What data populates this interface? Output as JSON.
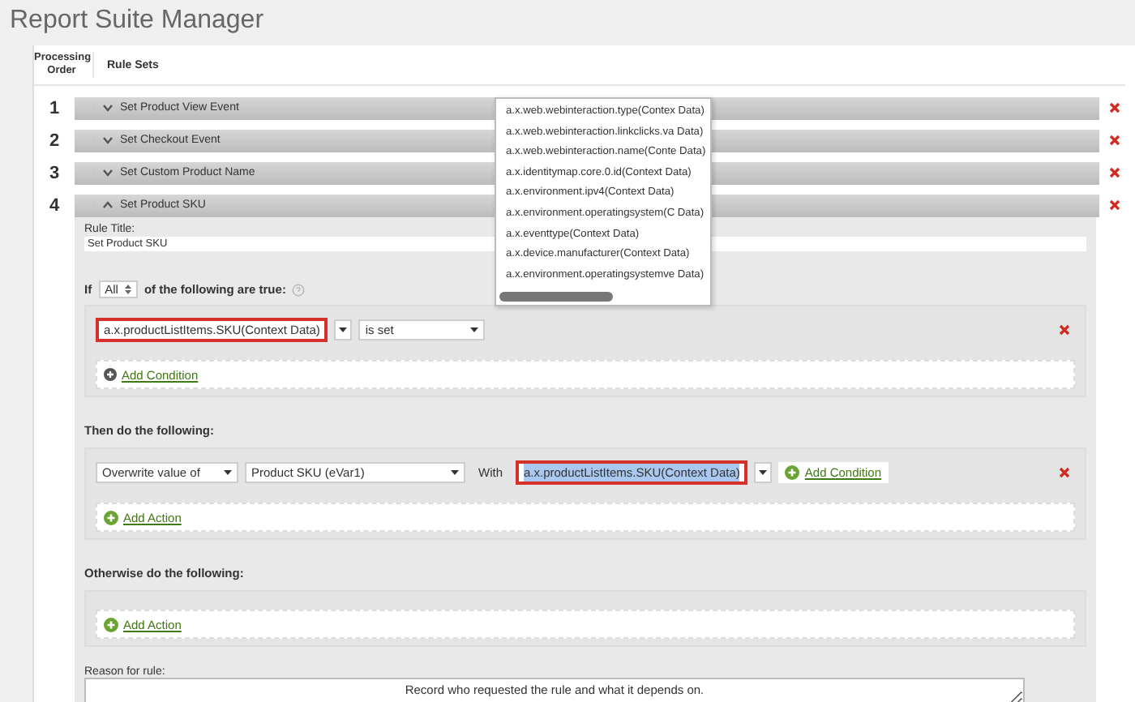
{
  "header": {
    "title": "Report Suite Manager"
  },
  "columns": [
    "Processing Order",
    "Rule Sets"
  ],
  "rules": [
    {
      "order": "1",
      "name": "Set Product View Event",
      "expanded": false
    },
    {
      "order": "2",
      "name": "Set Checkout Event",
      "expanded": false
    },
    {
      "order": "3",
      "name": "Set Custom Product Name",
      "expanded": false
    },
    {
      "order": "4",
      "name": "Set Product SKU",
      "expanded": true
    }
  ],
  "editor": {
    "rule_title_label": "Rule Title:",
    "rule_title_value": "Set Product SKU",
    "if_prefix": "If",
    "match_select": "All",
    "if_suffix": "of the following are true:",
    "conditions": [
      {
        "variable": "a.x.productListItems.SKU(Context Data)",
        "operator": "is set",
        "highlighted": true
      }
    ],
    "add_condition": "Add Condition",
    "then_label": "Then do the following:",
    "actions": [
      {
        "operation": "Overwrite value of",
        "target": "Product SKU (eVar1)",
        "with_label": "With",
        "value": "a.x.productListItems.SKU(Context Data)",
        "highlighted": true,
        "value_selected": true,
        "add_condition": "Add Condition"
      }
    ],
    "add_action": "Add Action",
    "otherwise_label": "Otherwise do the following:",
    "otherwise_add_action": "Add Action",
    "reason_label": "Reason for rule:",
    "reason_placeholder": "Record who requested the rule and what it depends on."
  },
  "dropdown": {
    "items": [
      "a.x.web.webinteraction.type(Contex Data)",
      "a.x.web.webinteraction.linkclicks.va Data)",
      "a.x.web.webinteraction.name(Conte Data)",
      "a.x.identitymap.core.0.id(Context Data)",
      "a.x.environment.ipv4(Context Data)",
      "a.x.environment.operatingsystem(C Data)",
      "a.x.eventtype(Context Data)",
      "a.x.device.manufacturer(Context Data)",
      "a.x.environment.operatingsystemve Data)"
    ]
  }
}
